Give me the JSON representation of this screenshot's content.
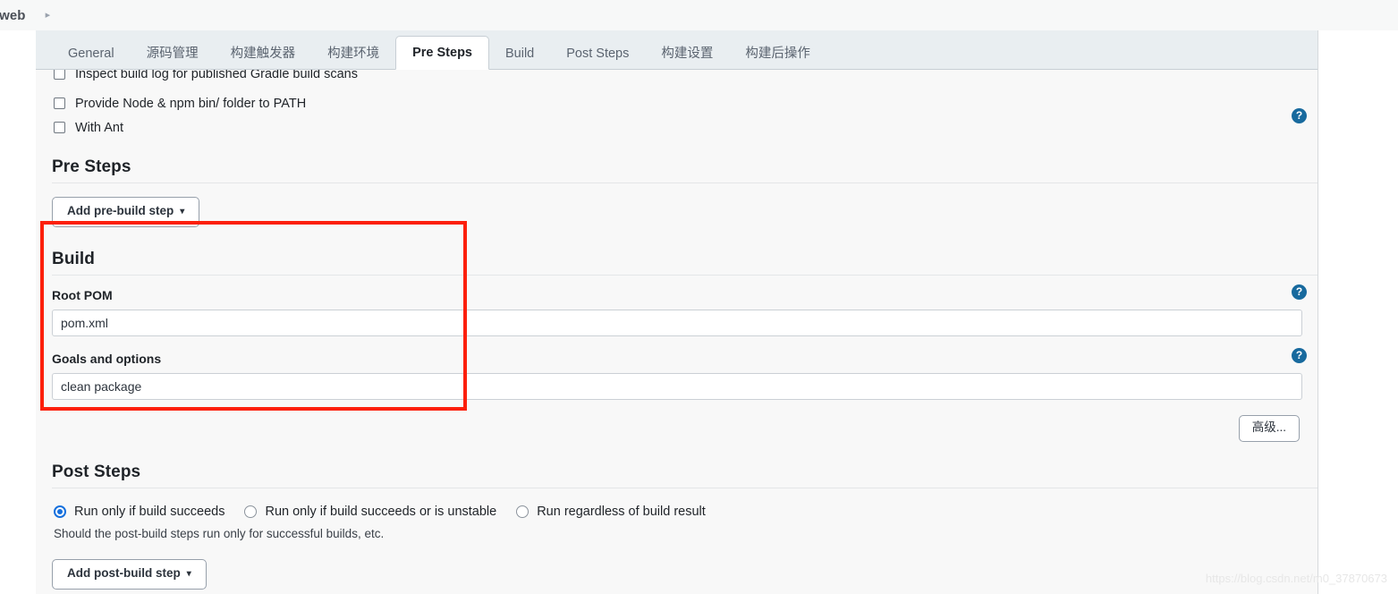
{
  "breadcrumb": {
    "current": "-web",
    "separator": "▸"
  },
  "tabs": [
    {
      "label": "General",
      "active": false
    },
    {
      "label": "源码管理",
      "active": false
    },
    {
      "label": "构建触发器",
      "active": false
    },
    {
      "label": "构建环境",
      "active": false
    },
    {
      "label": "Pre Steps",
      "active": true
    },
    {
      "label": "Build",
      "active": false
    },
    {
      "label": "Post Steps",
      "active": false
    },
    {
      "label": "构建设置",
      "active": false
    },
    {
      "label": "构建后操作",
      "active": false
    }
  ],
  "build_environment": {
    "checkboxes": [
      {
        "label": "Inspect build log for published Gradle build scans",
        "checked": false,
        "clipped": true
      },
      {
        "label": "Provide Node & npm bin/ folder to PATH",
        "checked": false,
        "clipped": false
      },
      {
        "label": "With Ant",
        "checked": false,
        "clipped": false
      }
    ]
  },
  "pre_steps": {
    "title": "Pre Steps",
    "add_button": "Add pre-build step",
    "caret": "▾"
  },
  "build": {
    "title": "Build",
    "root_pom": {
      "label": "Root POM",
      "value": "pom.xml"
    },
    "goals": {
      "label": "Goals and options",
      "value": "clean package"
    },
    "advanced_button": "高级..."
  },
  "post_steps": {
    "title": "Post Steps",
    "options": [
      {
        "label": "Run only if build succeeds",
        "selected": true
      },
      {
        "label": "Run only if build succeeds or is unstable",
        "selected": false
      },
      {
        "label": "Run regardless of build result",
        "selected": false
      }
    ],
    "hint": "Should the post-build steps run only for successful builds, etc.",
    "add_button": "Add post-build step",
    "caret": "▾"
  },
  "help_icon_glyph": "?",
  "watermark": "https://blog.csdn.net/m0_37870673",
  "colors": {
    "accent_blue": "#186a9e",
    "radio_blue": "#1670dd",
    "highlight_red": "#fc1f0b",
    "tabbar_bg": "#e9eef1",
    "panel_bg": "#f8f8f8"
  }
}
